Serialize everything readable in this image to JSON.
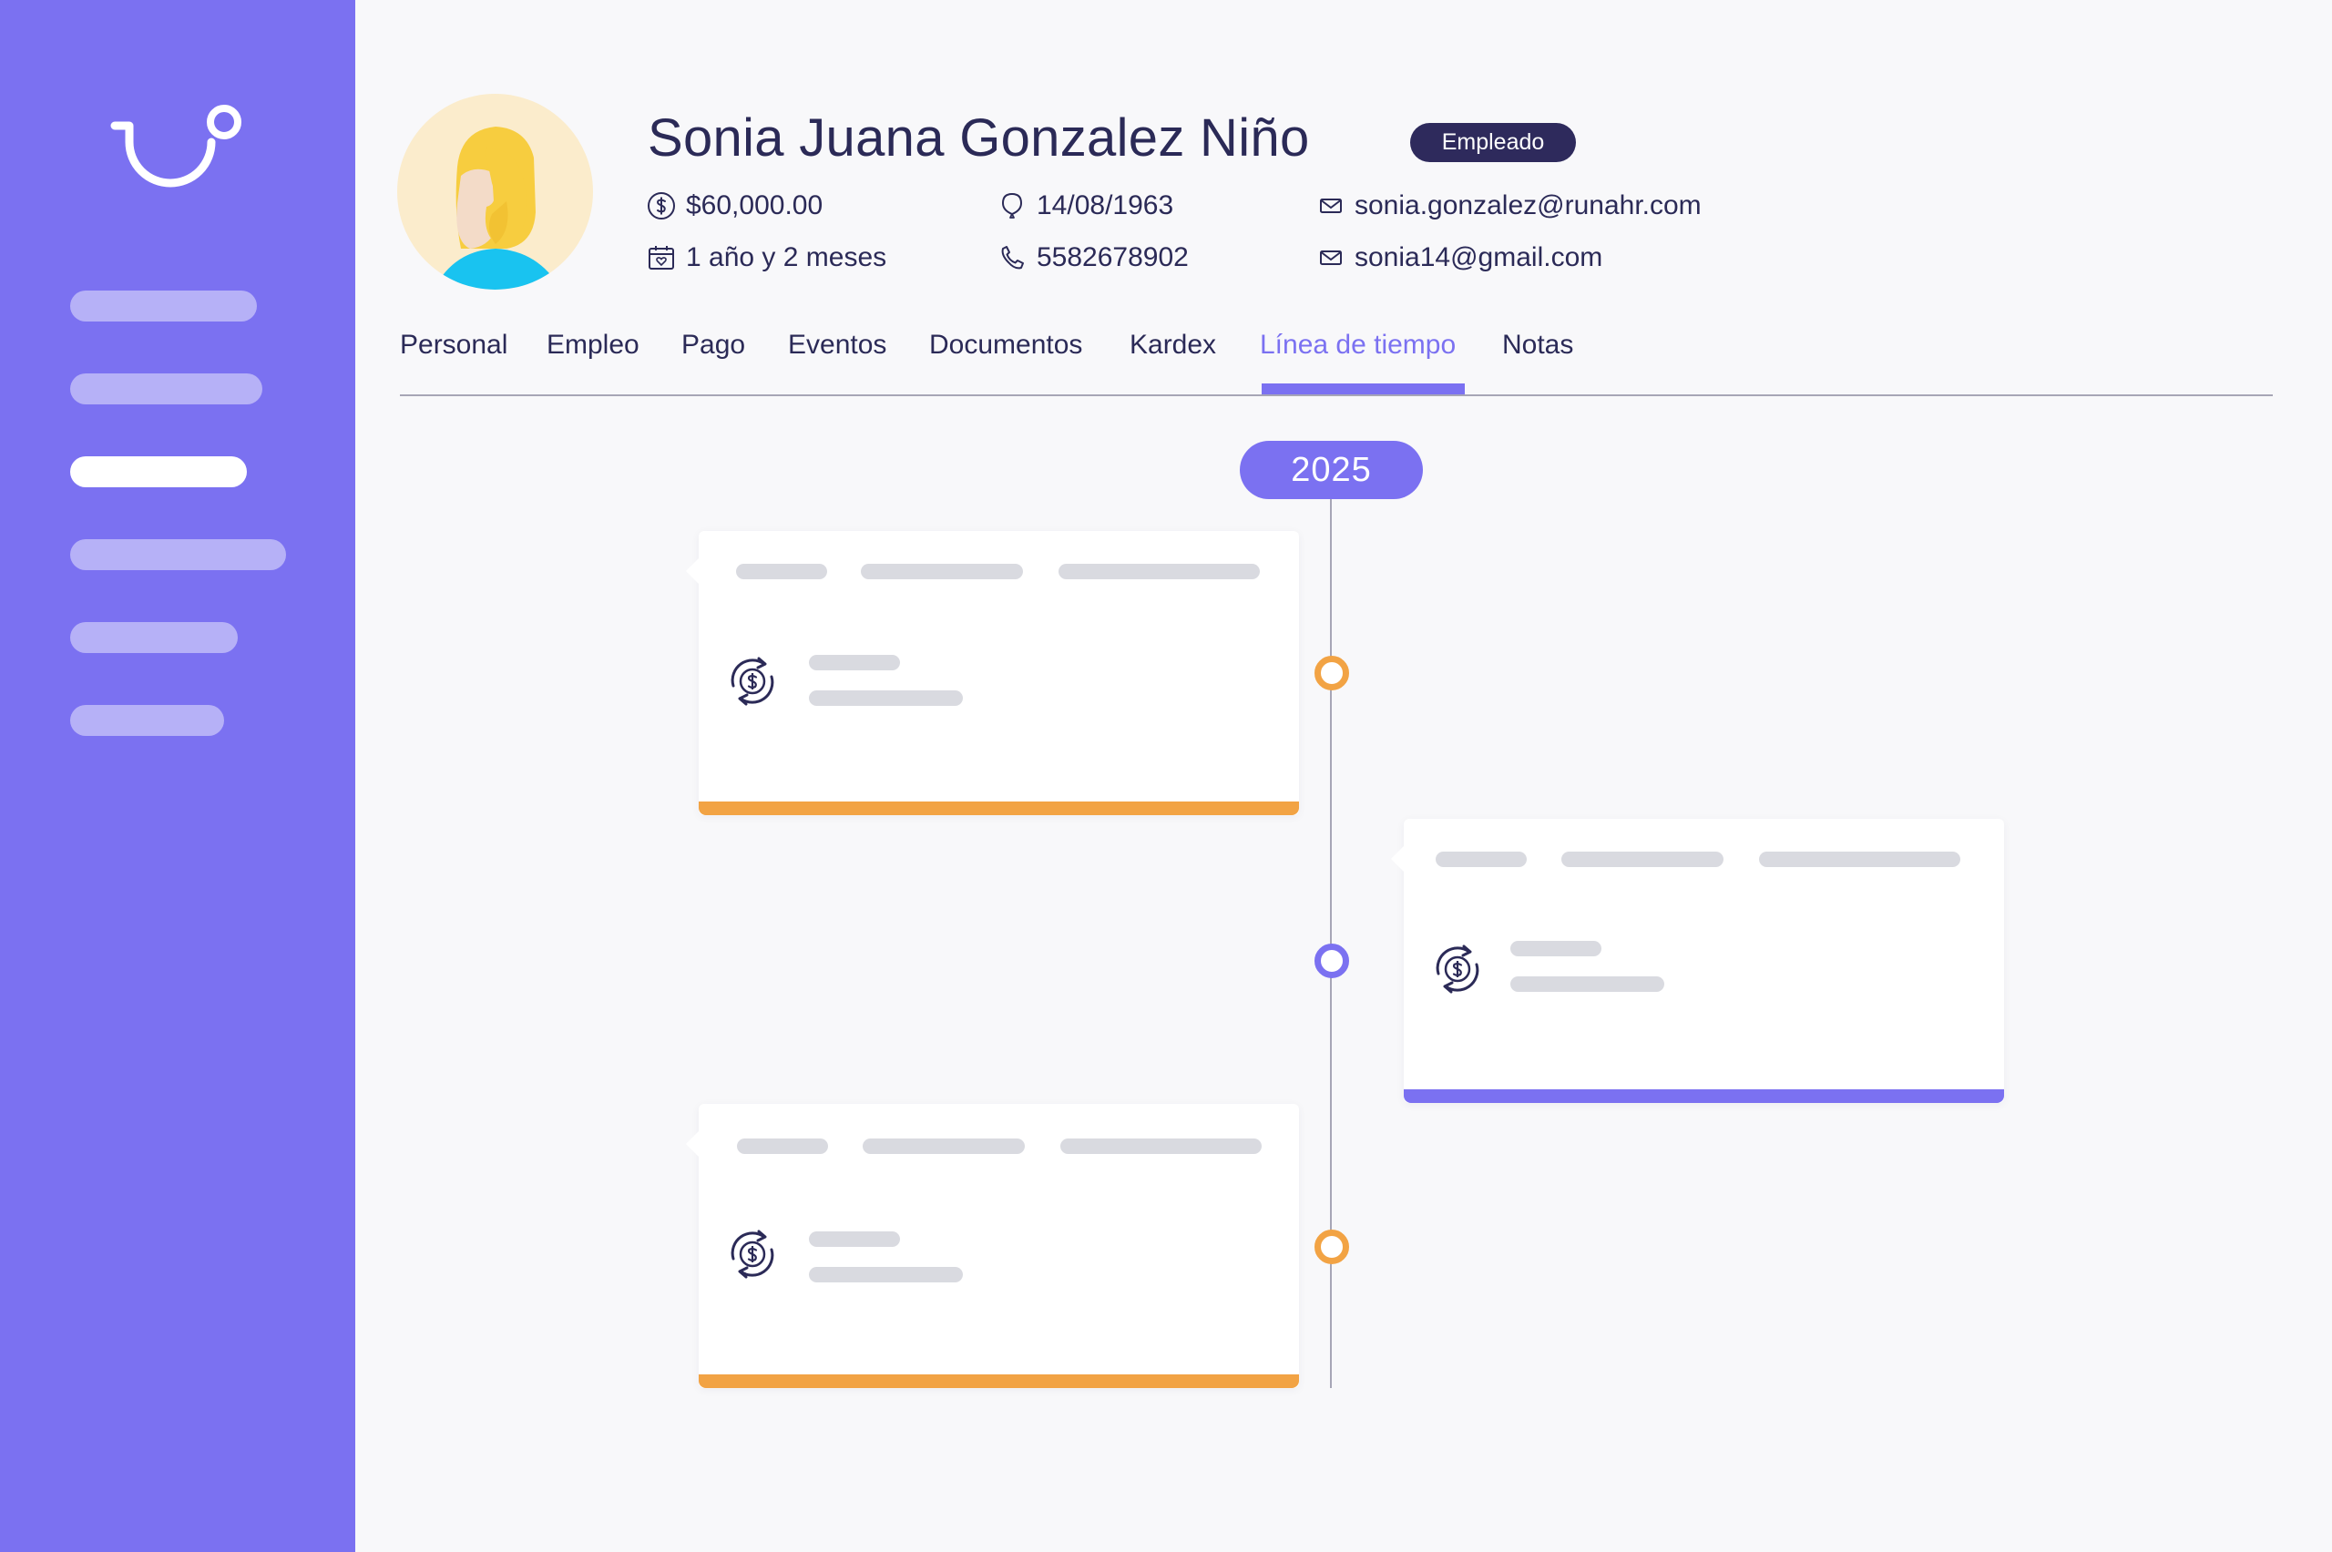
{
  "app": {
    "accent_color": "#7b71f1",
    "warning_color": "#f2a344",
    "logo_icon": "runa-logo-icon"
  },
  "sidebar": {
    "items": [
      {
        "id": "nav-1",
        "active": false
      },
      {
        "id": "nav-2",
        "active": false
      },
      {
        "id": "nav-3",
        "active": true
      },
      {
        "id": "nav-4",
        "active": false
      },
      {
        "id": "nav-5",
        "active": false
      },
      {
        "id": "nav-6",
        "active": false
      }
    ]
  },
  "profile": {
    "name": "Sonia Juana Gonzalez Niño",
    "badge": "Empleado",
    "salary": "$60,000.00",
    "birthdate": "14/08/1963",
    "work_email": "sonia.gonzalez@runahr.com",
    "tenure": "1 año y 2 meses",
    "phone": "5582678902",
    "personal_email": "sonia14@gmail.com"
  },
  "tabs": [
    {
      "label": "Personal",
      "active": false
    },
    {
      "label": "Empleo",
      "active": false
    },
    {
      "label": "Pago",
      "active": false
    },
    {
      "label": "Eventos",
      "active": false
    },
    {
      "label": "Documentos",
      "active": false
    },
    {
      "label": "Kardex",
      "active": false
    },
    {
      "label": "Línea de tiempo",
      "active": true
    },
    {
      "label": "Notas",
      "active": false
    }
  ],
  "timeline": {
    "year": "2025",
    "events": [
      {
        "side": "left",
        "color": "#f2a344",
        "icon": "salary-change-icon"
      },
      {
        "side": "right",
        "color": "#7b71f1",
        "icon": "salary-change-icon"
      },
      {
        "side": "left",
        "color": "#f2a344",
        "icon": "salary-change-icon"
      }
    ]
  }
}
